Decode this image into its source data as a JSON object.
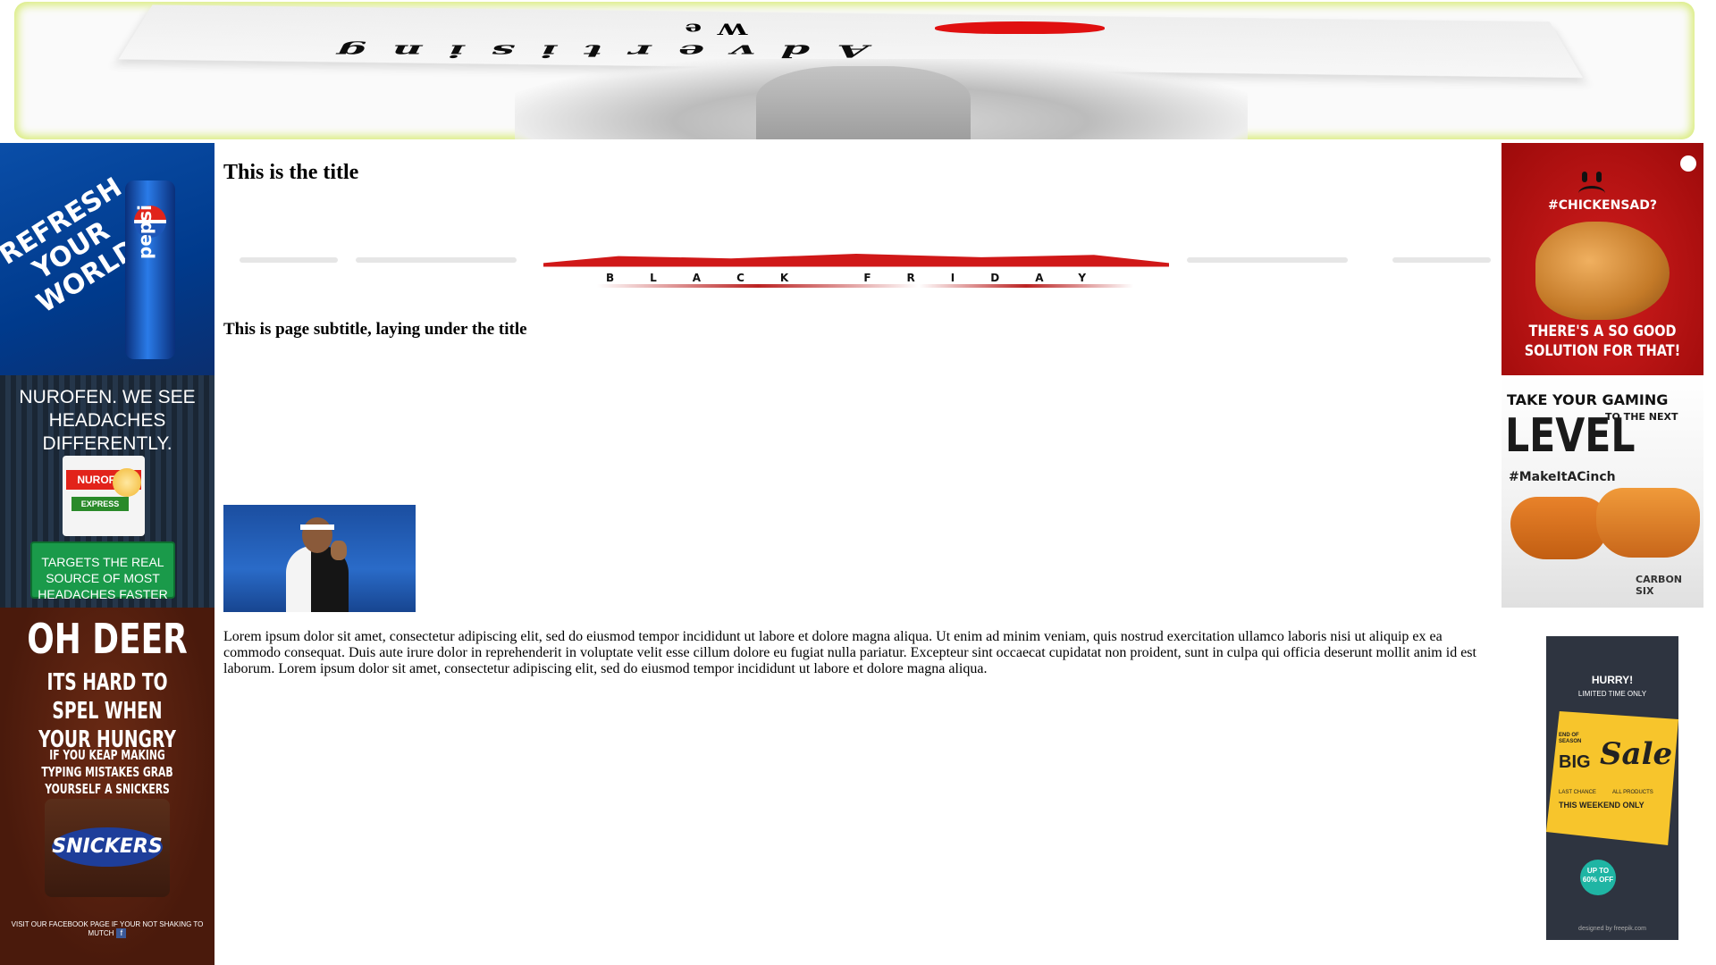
{
  "banner": {
    "line1": "We",
    "line2": "Advertising"
  },
  "ads": {
    "pepsi": {
      "slogan": "REFRESH YOUR WORLD",
      "can_text": "pepsi"
    },
    "nurofen": {
      "headline": "NUROFEN. WE SEE HEADACHES DIFFERENTLY.",
      "brand": "NUROFEN",
      "variant": "EXPRESS",
      "cta": "TARGETS THE REAL SOURCE OF MOST HEADACHES FASTER"
    },
    "snickers": {
      "line1": "OH DEER",
      "line2": "ITS HARD TO SPEL WHEN YOUR HUNGRY",
      "line3": "IF YOU KEAP MAKING TYPING MISTAKES GRAB YOURSELF A SNICKERS FAST",
      "brand": "SNICKERS",
      "footer": "VISIT OUR FACEBOOK PAGE IF YOUR NOT SHAKING TO MUTCH",
      "fb": "f"
    },
    "kfc": {
      "hashtag": "#CHICKENSAD?",
      "tagline": "THERE'S A SO GOOD SOLUTION FOR THAT!"
    },
    "gaming": {
      "take": "TAKE YOUR GAMING",
      "next": "TO THE NEXT",
      "level": "LEVEL",
      "hashtag": "#MakeItACinch",
      "product": "CARBON SIX"
    },
    "sale": {
      "hurry": "HURRY!",
      "limited": "LIMITED TIME ONLY",
      "end": "END OF SEASON",
      "big": "BIG",
      "sale": "Sale",
      "last": "LAST CHANCE",
      "all": "ALL PRODUCTS",
      "weekend": "THIS WEEKEND ONLY",
      "badge": "UP TO 60% OFF",
      "credit": "designed by freepik.com"
    }
  },
  "main": {
    "title": "This is the title",
    "subtitle": "This is page subtitle, laying under the title",
    "body": "Lorem ipsum dolor sit amet, consectetur adipiscing elit, sed do eiusmod tempor incididunt ut labore et dolore magna aliqua. Ut enim ad minim veniam, quis nostrud exercitation ullamco laboris nisi ut aliquip ex ea commodo consequat. Duis aute irure dolor in reprehenderit in voluptate velit esse cillum dolore eu fugiat nulla pariatur. Excepteur sint occaecat cupidatat non proident, sunt in culpa qui officia deserunt mollit anim id est laborum. Lorem ipsum dolor sit amet, consectetur adipiscing elit, sed do eiusmod tempor incididunt ut labore et dolore magna aliqua.",
    "promo_text": "BLACK FRIDAY"
  }
}
